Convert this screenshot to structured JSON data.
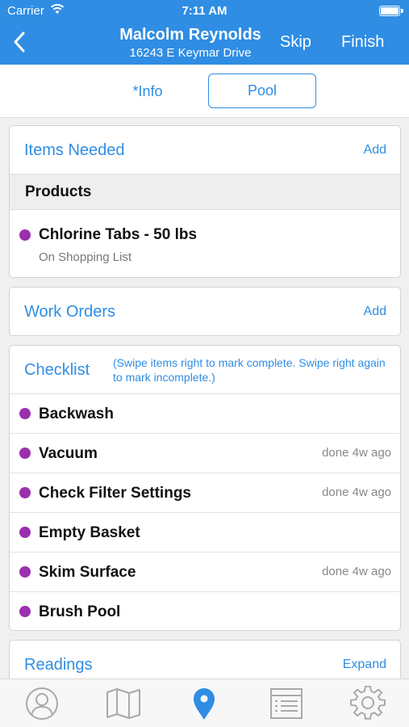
{
  "status": {
    "carrier": "Carrier",
    "time": "7:11 AM"
  },
  "nav": {
    "name": "Malcolm Reynolds",
    "address": "16243 E Keymar Drive",
    "skip": "Skip",
    "finish": "Finish"
  },
  "segments": {
    "info": "*Info",
    "pool": "Pool",
    "selected": "Pool"
  },
  "items_needed": {
    "title": "Items Needed",
    "action": "Add",
    "products_header": "Products",
    "products": [
      {
        "name": "Chlorine Tabs - 50 lbs",
        "status": "On Shopping List"
      }
    ]
  },
  "work_orders": {
    "title": "Work Orders",
    "action": "Add"
  },
  "checklist": {
    "title": "Checklist",
    "note": "(Swipe items right to mark complete. Swipe right again to mark incomplete.)",
    "items": [
      {
        "label": "Backwash",
        "done": ""
      },
      {
        "label": "Vacuum",
        "done": "done 4w ago"
      },
      {
        "label": "Check Filter Settings",
        "done": "done 4w ago"
      },
      {
        "label": "Empty Basket",
        "done": ""
      },
      {
        "label": "Skim Surface",
        "done": "done 4w ago"
      },
      {
        "label": "Brush Pool",
        "done": ""
      }
    ]
  },
  "readings": {
    "title": "Readings",
    "action": "Expand"
  },
  "tabbar": {
    "tabs": [
      "person-icon",
      "map-icon",
      "location-pin-icon",
      "list-icon",
      "gear-icon"
    ],
    "active": "location-pin-icon"
  },
  "colors": {
    "accent": "#2f8de4",
    "dot": "#9b2fae",
    "tab_inactive": "#a9a9a9"
  }
}
